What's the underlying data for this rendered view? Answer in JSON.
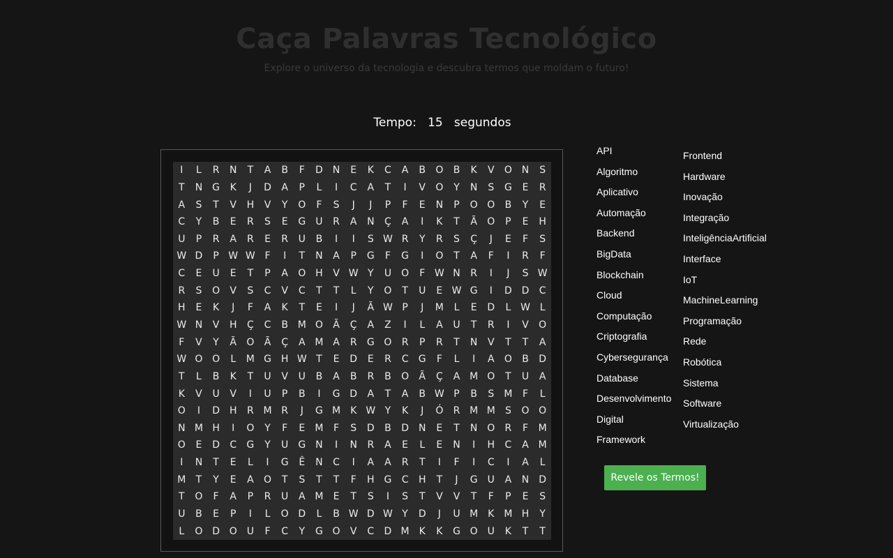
{
  "header": {
    "title": "Caça Palavras Tecnológico",
    "subtitle": "Explore o universo da tecnologia e descubra termos que moldam o futuro!"
  },
  "timer": {
    "label": "Tempo:",
    "value": "15",
    "unit": "segundos"
  },
  "grid": [
    "ILRNTABFDNEKCABOBKVONS",
    "TNGKJDAPLICATIVOYNSGER",
    "ASTVHVYOFSJJPFENPOOBYE",
    "CYBERSEGURANÇAIKTÃOPEH",
    "UPRARERUBIISWRYRSÇJEFS",
    "WDPWWFITNAPGFGIOTAFIRF",
    "CEUETPAOHVWYUOFWNRIJSW",
    "RSOVSCVCTTLYOTUEWGIDDC",
    "HEKJFAKTEIJÃWPJMLEDLWL",
    "WNVHÇCBMOÃÇAZILAUTRIVO",
    "FVYÃOÃÇAMARGORPRTNVTTA",
    "WOOLMGHWTEDERCGFLIAOBD",
    "TLBKTUVUBABRBOÃÇAMOTUA",
    "KVUVIUPBIGDATABWPBSMFL",
    "OIDHRMRJGMKWYKJÓRMMSOO",
    "NMHIOYFEMFSDBDNETNORFM",
    "OEDCGYUGNINRAELENIHCAM",
    "INTELIGÊNCIAARTIFICIAL",
    "MTYEAOTSTTFHGCHTJGUAND",
    "TOFAPRUAMETSISTVVTFPES",
    "UBEPILODLBWDWYDJUMKMHY",
    "LODOUFCYGOVCDMKKGOUKTT"
  ],
  "words_col1": [
    "API",
    "Algoritmo",
    "Aplicativo",
    "Automação",
    "Backend",
    "BigData",
    "Blockchain",
    "Cloud",
    "Computação",
    "Criptografia",
    "Cybersegurança",
    "Database",
    "Desenvolvimento",
    "Digital",
    "Framework"
  ],
  "words_col2": [
    "Frontend",
    "Hardware",
    "Inovação",
    "Integração",
    "InteligênciaArtificial",
    "Interface",
    "IoT",
    "MachineLearning",
    "Programação",
    "Rede",
    "Robótica",
    "Sistema",
    "Software",
    "Virtualização"
  ],
  "reveal_button": {
    "label": "Revele os Termos!"
  },
  "colors": {
    "background": "#151515",
    "board": "#2b2b2b",
    "button": "#4caf50"
  }
}
